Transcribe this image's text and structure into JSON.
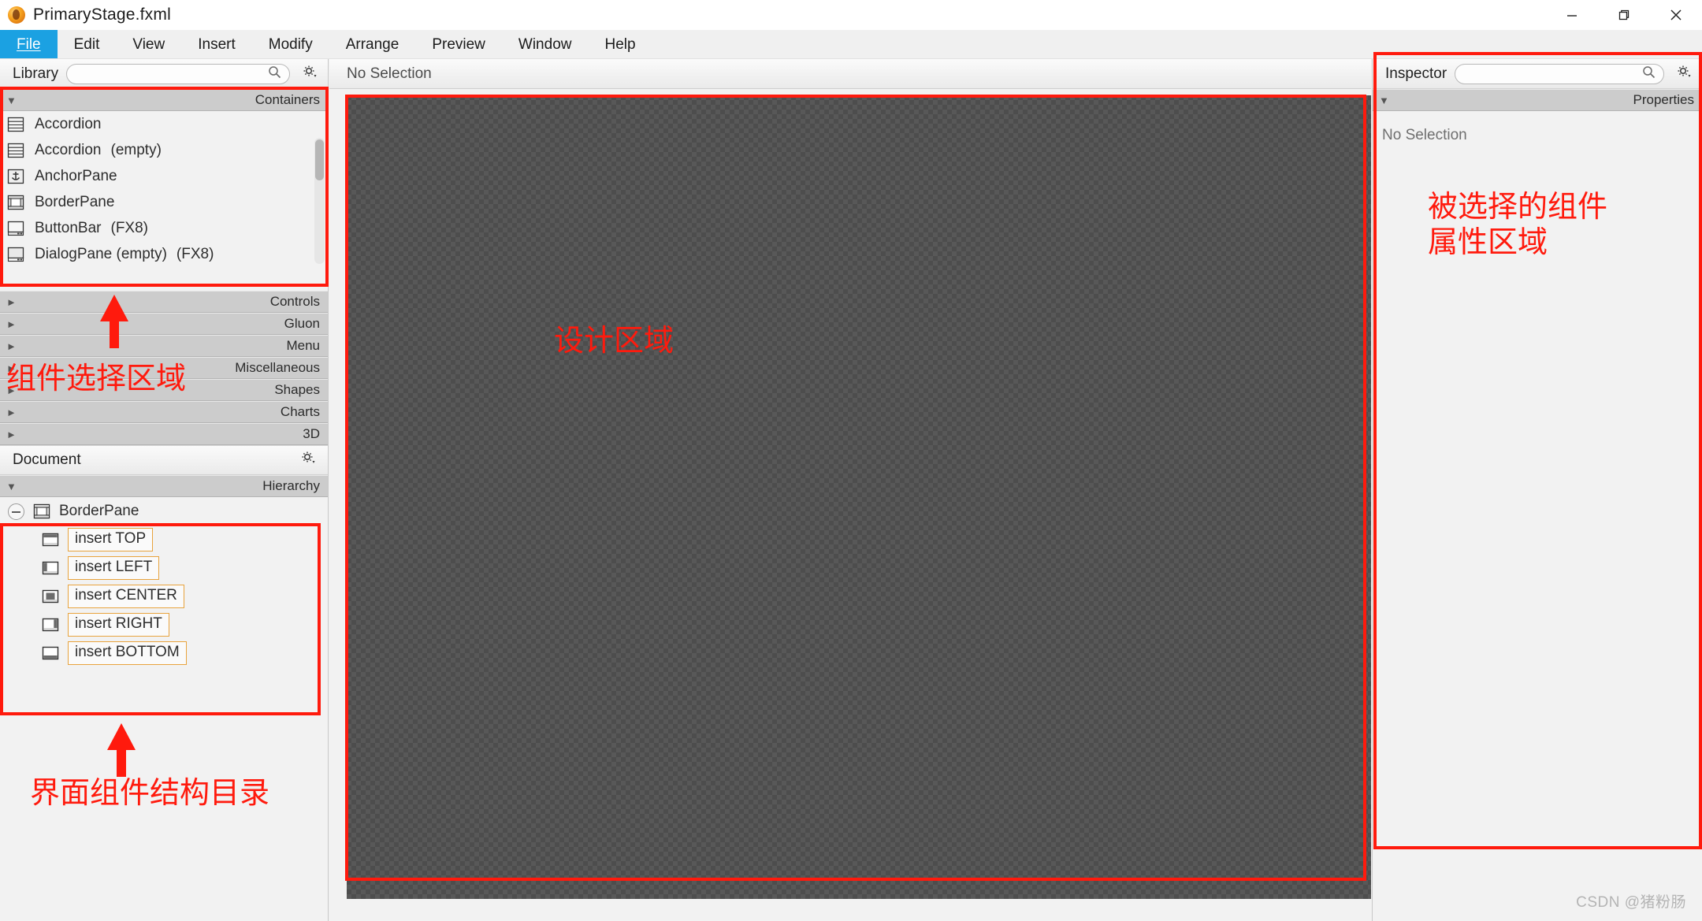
{
  "window": {
    "title": "PrimaryStage.fxml",
    "app_icon": "scenebuilder-icon",
    "minimize_label": "Minimize",
    "maximize_label": "Restore",
    "close_label": "Close"
  },
  "menubar": {
    "items": [
      {
        "label": "File",
        "mnemonic": "F",
        "active": true
      },
      {
        "label": "Edit",
        "mnemonic": "E",
        "active": false
      },
      {
        "label": "View",
        "mnemonic": "V",
        "active": false
      },
      {
        "label": "Insert",
        "mnemonic": "I",
        "active": false
      },
      {
        "label": "Modify",
        "mnemonic": "M",
        "active": false
      },
      {
        "label": "Arrange",
        "mnemonic": "A",
        "active": false
      },
      {
        "label": "Preview",
        "mnemonic": "P",
        "active": false
      },
      {
        "label": "Window",
        "mnemonic": "W",
        "active": false
      },
      {
        "label": "Help",
        "mnemonic": "",
        "active": false
      }
    ]
  },
  "library": {
    "title": "Library",
    "search_placeholder": "",
    "search_value": "",
    "search_icon": "search-icon",
    "gear_icon": "gear-icon",
    "open_section": "Containers",
    "items": [
      {
        "name": "Accordion",
        "suffix": "",
        "icon": "accordion-icon"
      },
      {
        "name": "Accordion",
        "suffix": "(empty)",
        "icon": "accordion-icon"
      },
      {
        "name": "AnchorPane",
        "suffix": "",
        "icon": "anchorpane-icon"
      },
      {
        "name": "BorderPane",
        "suffix": "",
        "icon": "borderpane-icon"
      },
      {
        "name": "ButtonBar",
        "suffix": "(FX8)",
        "icon": "buttonbar-icon"
      },
      {
        "name": "DialogPane (empty)",
        "suffix": "(FX8)",
        "icon": "dialogpane-icon"
      }
    ],
    "sections": [
      {
        "label": "Controls",
        "expanded": false
      },
      {
        "label": "Gluon",
        "expanded": false
      },
      {
        "label": "Menu",
        "expanded": false
      },
      {
        "label": "Miscellaneous",
        "expanded": false
      },
      {
        "label": "Shapes",
        "expanded": false
      },
      {
        "label": "Charts",
        "expanded": false
      },
      {
        "label": "3D",
        "expanded": false
      }
    ]
  },
  "document": {
    "title": "Document",
    "gear_icon": "gear-icon",
    "hierarchy_label": "Hierarchy",
    "tree": {
      "root": {
        "label": "BorderPane",
        "icon": "borderpane-icon",
        "expanded": true
      },
      "children": [
        {
          "label": "insert TOP",
          "icon": "region-top-icon"
        },
        {
          "label": "insert LEFT",
          "icon": "region-left-icon"
        },
        {
          "label": "insert CENTER",
          "icon": "region-center-icon"
        },
        {
          "label": "insert RIGHT",
          "icon": "region-right-icon"
        },
        {
          "label": "insert BOTTOM",
          "icon": "region-bottom-icon"
        }
      ]
    }
  },
  "content": {
    "selection_status": "No Selection"
  },
  "inspector": {
    "title": "Inspector",
    "search_placeholder": "",
    "search_value": "",
    "search_icon": "search-icon",
    "gear_icon": "gear-icon",
    "properties_label": "Properties",
    "empty_text": "No Selection"
  },
  "annotations": {
    "accent_color": "#ff1a0d",
    "library_region": "组件选择区域",
    "hierarchy_region": "界面组件结构目录",
    "design_region": "设计区域",
    "inspector_region": "被选择的组件\n属性区域"
  },
  "watermark": "CSDN @猪粉肠"
}
